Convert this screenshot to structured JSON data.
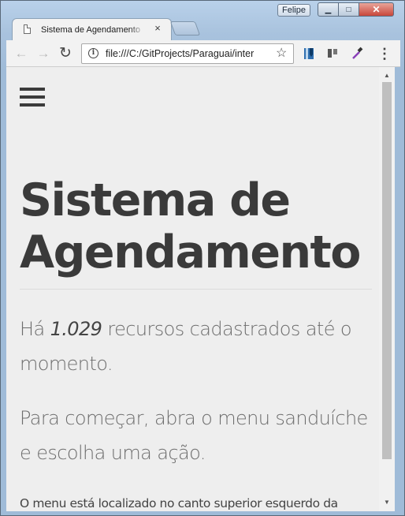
{
  "window": {
    "profile_name": "Felipe",
    "minimize_glyph": "▁",
    "maximize_glyph": "□",
    "close_glyph": "✕"
  },
  "tab": {
    "title": "Sistema de Agendamento",
    "close_glyph": "×"
  },
  "toolbar": {
    "back_glyph": "←",
    "forward_glyph": "→",
    "reload_glyph": "↻",
    "url": "file:///C:/GitProjects/Paraguai/inter",
    "info_glyph": "i",
    "star_glyph": "☆",
    "menu_glyph": "⋮"
  },
  "page": {
    "title": "Sistema de Agendamento",
    "resources_prefix": "Há ",
    "resources_count": "1.029",
    "resources_suffix": " recursos cadastrados até o momento.",
    "instruction": "Para começar, abra o menu sanduíche e escolha uma ação.",
    "menu_hint": "O menu está localizado no canto superior esquerdo da"
  },
  "scrollbar": {
    "up_glyph": "▲",
    "down_glyph": "▼"
  },
  "colors": {
    "page_background": "#eeeeee",
    "title_text": "#3a3a3a",
    "lead_text": "#6d6d6d",
    "close_button": "#c8463a"
  }
}
